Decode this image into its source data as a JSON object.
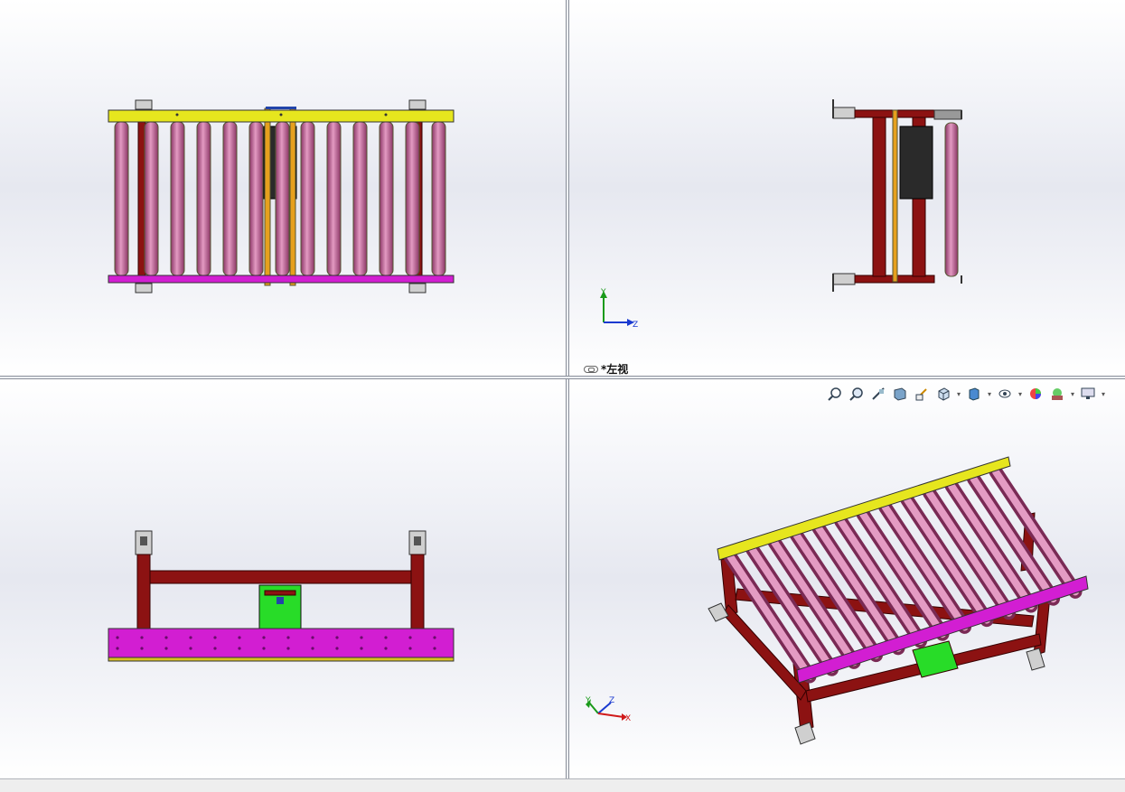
{
  "viewports": {
    "top_left": {
      "name": "top-view"
    },
    "top_right": {
      "name": "left-view",
      "label": "*左视"
    },
    "bottom_left": {
      "name": "front-view"
    },
    "bottom_right": {
      "name": "isometric-view"
    }
  },
  "triads": {
    "top_right": {
      "up": "Y",
      "right": "Z"
    },
    "bottom_right": {
      "y": "Y",
      "z": "Z",
      "x": "X"
    }
  },
  "toolbar": {
    "icons": [
      "zoom-to-fit-icon",
      "zoom-to-area-icon",
      "previous-view-icon",
      "section-view-icon",
      "dynamic-annotation-icon",
      "view-orientation-icon",
      "display-style-icon",
      "hide-show-items-icon",
      "edit-appearance-icon",
      "apply-scene-icon",
      "view-settings-icon"
    ]
  },
  "colors": {
    "top_rail": "#e6e61e",
    "bottom_rail": "#d21ed2",
    "roller": "#c8649b",
    "frame": "#8c1212",
    "guide": "#e6a01e",
    "motor_box": "#28dc28"
  }
}
